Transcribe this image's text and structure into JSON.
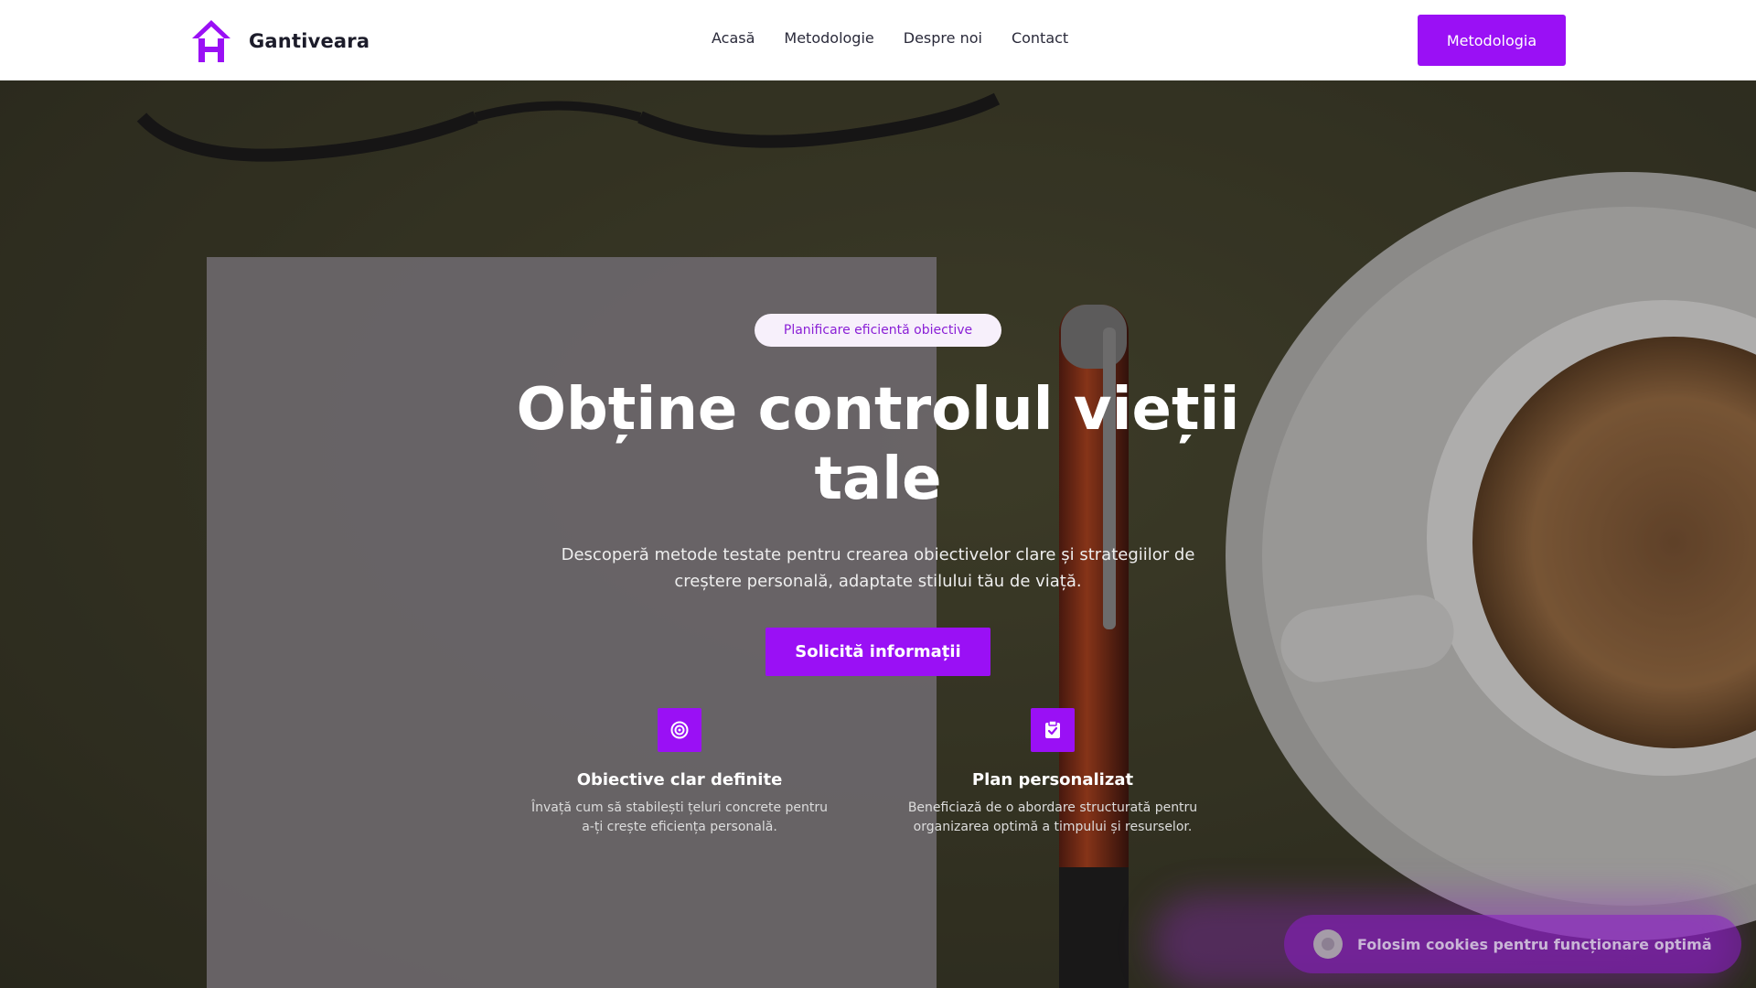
{
  "brand": {
    "name": "Gantiveara",
    "logo_icon": "house-h-logo-icon",
    "accent_color": "#9a10f5"
  },
  "nav": {
    "items": [
      {
        "label": "Acasă"
      },
      {
        "label": "Metodologie"
      },
      {
        "label": "Despre noi"
      },
      {
        "label": "Contact"
      }
    ],
    "cta_label": "Metodologia"
  },
  "hero": {
    "badge": "Planificare eficientă obiective",
    "headline": "Obține controlul vieții tale",
    "subtext": "Descoperă metode testate pentru crearea obiectivelor clare și strategiilor de creștere personală, adaptate stilului tău de viață.",
    "cta_label": "Solicită informații"
  },
  "features": [
    {
      "icon": "target-icon",
      "title": "Obiective clar definite",
      "description": "Învață cum să stabilești țeluri concrete pentru a-ți crește eficiența personală."
    },
    {
      "icon": "clipboard-check-icon",
      "title": "Plan personalizat",
      "description": "Beneficiază de o abordare structurată pentru organizarea optimă a timpului și resurselor."
    }
  ],
  "cookie_banner": {
    "text": "Folosim cookies pentru funcționare optimă"
  }
}
